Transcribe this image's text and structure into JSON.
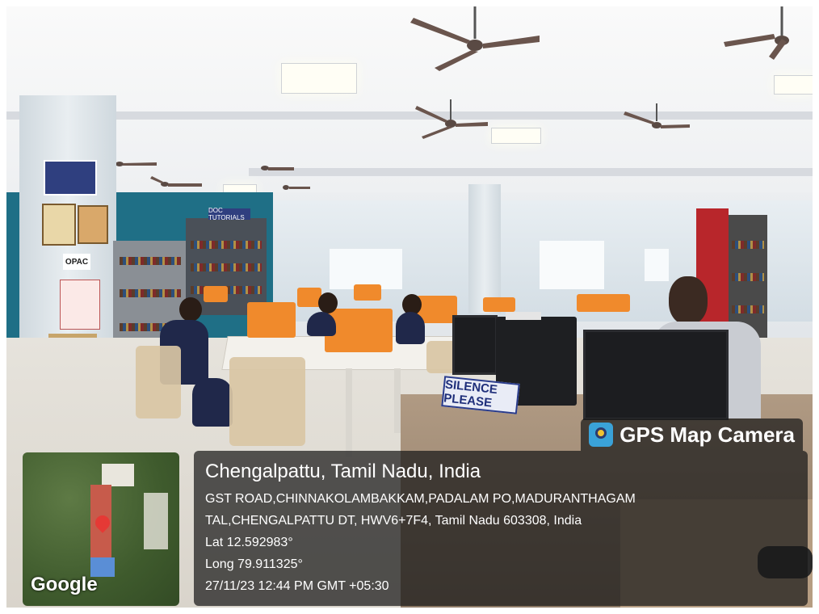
{
  "signs": {
    "silence": "SILENCE PLEASE",
    "opac": "OPAC",
    "doc_tutorials": "DOC TUTORIALS"
  },
  "overlay": {
    "brand": "GPS Map Camera",
    "location_title": "Chengalpattu, Tamil Nadu, India",
    "address_line1": "GST ROAD,CHINNAKOLAMBAKKAM,PADALAM PO,MADURANTHAGAM",
    "address_line2": "TAL,CHENGALPATTU DT, HWV6+7F4, Tamil Nadu 603308, India",
    "lat": "Lat 12.592983°",
    "long": "Long 79.911325°",
    "timestamp": "27/11/23 12:44 PM GMT +05:30",
    "map_label": "Google"
  },
  "colors": {
    "accent_orange": "#f08a2c",
    "wall_teal": "#1f6f86",
    "overlay_bg": "rgba(25,25,25,0.72)"
  }
}
